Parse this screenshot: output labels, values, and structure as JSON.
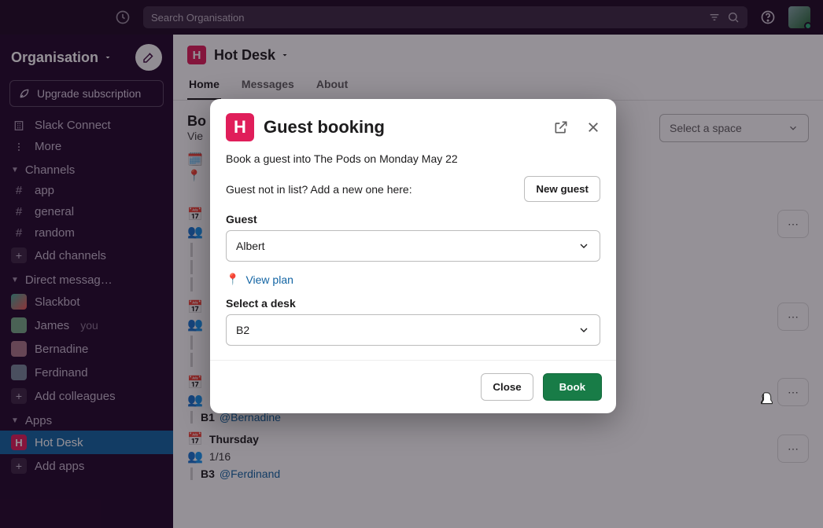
{
  "topbar": {
    "search_placeholder": "Search Organisation"
  },
  "workspace": {
    "name": "Organisation",
    "upgrade_label": "Upgrade subscription"
  },
  "sidebar": {
    "slack_connect": "Slack Connect",
    "more": "More",
    "channels_label": "Channels",
    "channels": [
      "app",
      "general",
      "random"
    ],
    "add_channels": "Add channels",
    "dms_label": "Direct messag…",
    "dms": [
      {
        "name": "Slackbot",
        "you": false
      },
      {
        "name": "James",
        "you": true
      },
      {
        "name": "Bernadine",
        "you": false
      },
      {
        "name": "Ferdinand",
        "you": false
      }
    ],
    "you_tag": "you",
    "add_colleagues": "Add colleagues",
    "apps_label": "Apps",
    "apps": [
      "Hot Desk"
    ],
    "add_apps": "Add apps"
  },
  "channel": {
    "name": "Hot Desk",
    "tabs": [
      "Home",
      "Messages",
      "About"
    ],
    "active_tab": 0
  },
  "content": {
    "heading_prefix": "Bo",
    "subtitle_prefix": "Vie",
    "select_space_placeholder": "Select a space",
    "days": [
      {
        "name": "",
        "capacity": "",
        "desks": []
      },
      {
        "name": "",
        "capacity": "",
        "desks": [
          {
            "code": "B1",
            "mention": "@Bernadine"
          }
        ]
      },
      {
        "name": "Thursday",
        "capacity": "1/16",
        "desks": [
          {
            "code": "B3",
            "mention": "@Ferdinand"
          }
        ]
      }
    ]
  },
  "modal": {
    "title": "Guest booking",
    "intro": "Book a guest into The Pods on Monday May 22",
    "not_in_list": "Guest not in list? Add a new one here:",
    "new_guest_label": "New guest",
    "guest_label": "Guest",
    "guest_value": "Albert",
    "view_plan": "View plan",
    "desk_label": "Select a desk",
    "desk_value": "B2",
    "close_label": "Close",
    "book_label": "Book"
  }
}
